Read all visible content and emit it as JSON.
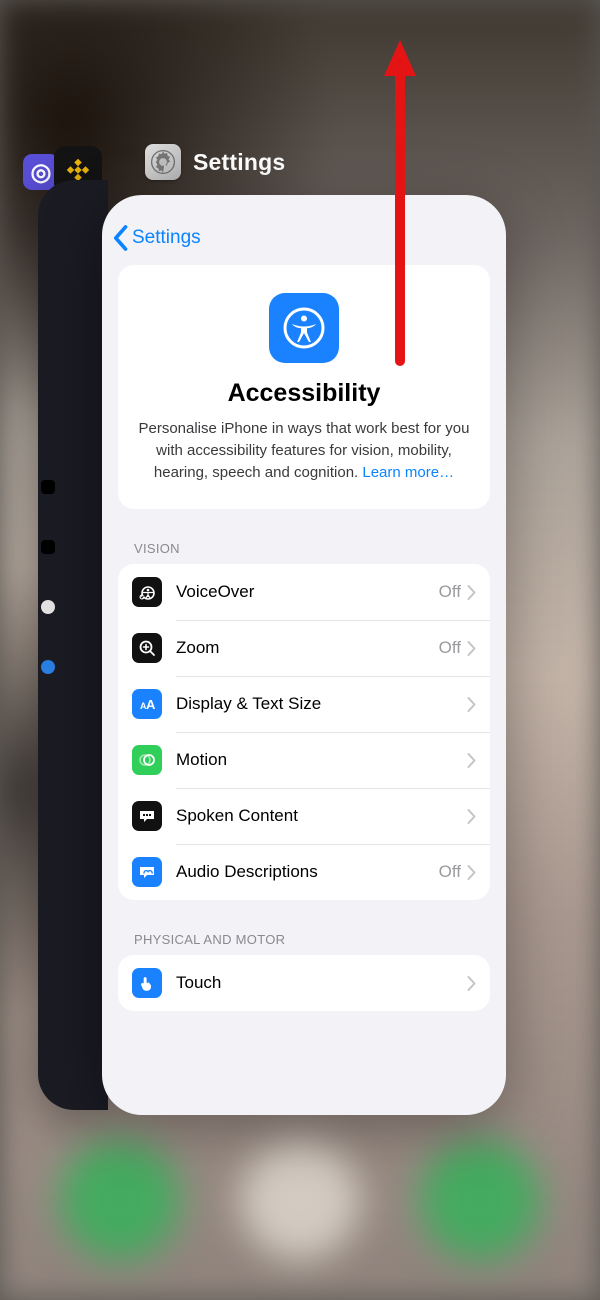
{
  "switcher": {
    "app_title": "Settings"
  },
  "nav": {
    "back_label": "Settings"
  },
  "intro": {
    "title": "Accessibility",
    "body": "Personalise iPhone in ways that work best for you with accessibility features for vision, mobility, hearing, speech and cognition. ",
    "link": "Learn more…"
  },
  "sections": {
    "vision": {
      "label": "VISION",
      "rows": [
        {
          "icon": "voiceover-icon",
          "label": "VoiceOver",
          "value": "Off"
        },
        {
          "icon": "zoom-icon",
          "label": "Zoom",
          "value": "Off"
        },
        {
          "icon": "text-size-icon",
          "label": "Display & Text Size",
          "value": ""
        },
        {
          "icon": "motion-icon",
          "label": "Motion",
          "value": ""
        },
        {
          "icon": "spoken-content-icon",
          "label": "Spoken Content",
          "value": ""
        },
        {
          "icon": "audio-desc-icon",
          "label": "Audio Descriptions",
          "value": "Off"
        }
      ]
    },
    "motor": {
      "label": "PHYSICAL AND MOTOR",
      "rows": [
        {
          "icon": "touch-icon",
          "label": "Touch",
          "value": ""
        }
      ]
    }
  },
  "colors": {
    "ios_blue": "#1a82ff",
    "link_blue": "#0b84ff",
    "bg_grey": "#f2f2f7",
    "green": "#2fcf5a"
  }
}
